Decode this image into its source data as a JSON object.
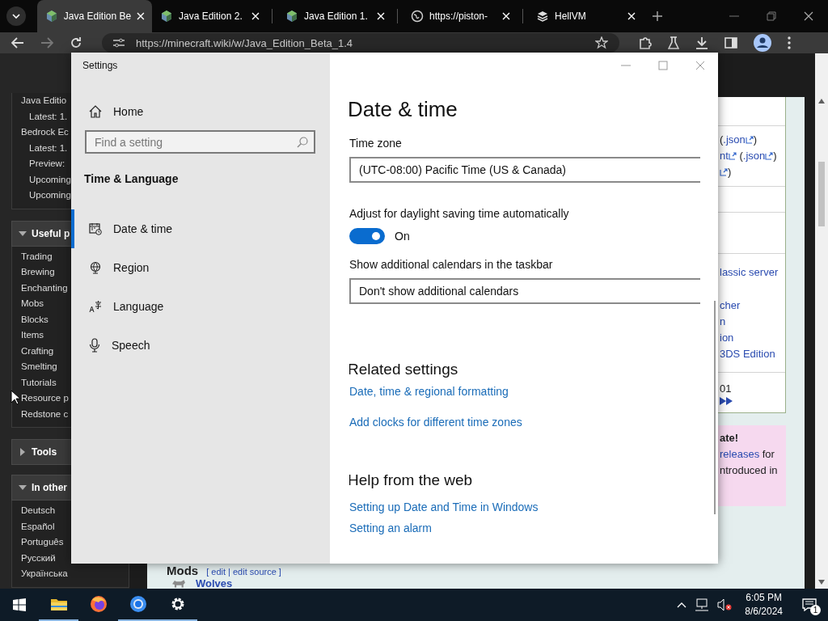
{
  "browser": {
    "tabs": [
      {
        "title": "Java Edition Be",
        "kind": "cube",
        "selected": true
      },
      {
        "title": "Java Edition 2.",
        "kind": "cube",
        "selected": false
      },
      {
        "title": "Java Edition 1.",
        "kind": "cube",
        "selected": false
      },
      {
        "title": "https://piston-",
        "kind": "globe",
        "selected": false
      },
      {
        "title": "HellVM",
        "kind": "vm",
        "selected": false
      }
    ],
    "address": "https://minecraft.wiki/w/Java_Edition_Beta_1.4"
  },
  "wiki": {
    "sidebar": [
      {
        "items": [
          {
            "label": "Java Editio",
            "children": [
              {
                "label": "Latest: 1."
              }
            ]
          },
          {
            "label": "Bedrock Ec",
            "children": [
              {
                "label": "Latest: 1."
              },
              {
                "label": "Preview: "
              },
              {
                "label": "Upcoming"
              },
              {
                "label": "Upcoming"
              }
            ]
          }
        ]
      },
      {
        "heading": "Useful p",
        "expanded": true,
        "items": [
          {
            "label": "Trading"
          },
          {
            "label": "Brewing"
          },
          {
            "label": "Enchanting"
          },
          {
            "label": "Mobs"
          },
          {
            "label": "Blocks"
          },
          {
            "label": "Items"
          },
          {
            "label": "Crafting"
          },
          {
            "label": "Smelting"
          },
          {
            "label": "Tutorials"
          },
          {
            "label": "Resource p"
          },
          {
            "label": "Redstone c"
          }
        ]
      },
      {
        "heading": "Tools",
        "expanded": false
      },
      {
        "heading": "In other",
        "expanded": true,
        "items": [
          {
            "label": "Deutsch"
          },
          {
            "label": "Español"
          },
          {
            "label": "Português"
          },
          {
            "label": "Русский"
          },
          {
            "label": "Українська"
          }
        ]
      }
    ],
    "infobox": [
      {
        "kind": "empty"
      },
      {
        "kind": "text",
        "lines": [
          [
            {
              "kind": "plain",
              "text": "("
            },
            {
              "kind": "link",
              "text": ".json"
            },
            {
              "kind": "ext"
            },
            {
              "kind": "plain",
              "text": ")"
            }
          ],
          [
            {
              "kind": "link",
              "text": "nt"
            },
            {
              "kind": "ext"
            },
            {
              "kind": "plain",
              "text": " ("
            },
            {
              "kind": "link",
              "text": ".json"
            },
            {
              "kind": "ext"
            },
            {
              "kind": "plain",
              "text": ")"
            }
          ],
          [
            {
              "kind": "ext"
            },
            {
              "kind": "plain",
              "text": ")"
            }
          ]
        ]
      },
      {
        "kind": "empty"
      },
      {
        "kind": "empty"
      },
      {
        "kind": "text",
        "lines": [
          [
            {
              "kind": "link",
              "text": "lassic server"
            }
          ],
          [
            {
              "kind": "link",
              "text": "cher",
              "spaced": true
            }
          ],
          [
            {
              "kind": "link",
              "text": "n"
            }
          ],
          [
            {
              "kind": "link",
              "text": "ion"
            }
          ],
          [
            {
              "kind": "link",
              "text": "3DS Edition"
            }
          ]
        ]
      },
      {
        "kind": "text",
        "lines": [
          [
            {
              "kind": "plain",
              "text": "01"
            }
          ],
          [
            {
              "kind": "arrows"
            }
          ]
        ]
      }
    ],
    "notice": [
      [
        {
          "kind": "bold",
          "text": "ate!"
        }
      ],
      [
        {
          "kind": "link",
          "text": "releases"
        },
        {
          "kind": "plain",
          "text": " for"
        }
      ],
      [
        {
          "kind": "plain",
          "text": "ntroduced in"
        }
      ]
    ],
    "section": {
      "heading": "Mods",
      "edit": "[ edit | edit source ]"
    },
    "entry": "Wolves"
  },
  "settings": {
    "title": "Settings",
    "home": "Home",
    "search_placeholder": "Find a setting",
    "section": "Time & Language",
    "nav": [
      {
        "label": "Date & time",
        "kind": "calendar",
        "selected": true
      },
      {
        "label": "Region",
        "kind": "globe",
        "selected": false
      },
      {
        "label": "Language",
        "kind": "language",
        "selected": false
      },
      {
        "label": "Speech",
        "kind": "mic",
        "selected": false
      }
    ],
    "page_title": "Date & time",
    "time_zone": {
      "label": "Time zone",
      "value": "(UTC-08:00) Pacific Time (US & Canada)"
    },
    "dst": {
      "label": "Adjust for daylight saving time automatically",
      "on": true,
      "state_text": "On"
    },
    "calendars": {
      "label": "Show additional calendars in the taskbar",
      "value": "Don't show additional calendars"
    },
    "related": {
      "heading": "Related settings",
      "links": [
        "Date, time & regional formatting",
        "Add clocks for different time zones"
      ]
    },
    "help": {
      "heading": "Help from the web",
      "links": [
        "Setting up Date and Time in Windows",
        "Setting an alarm"
      ]
    }
  },
  "taskbar": {
    "apps": [
      {
        "kind": "explorer",
        "running": true
      },
      {
        "kind": "firefox",
        "running": false
      },
      {
        "kind": "chrome",
        "running": true
      },
      {
        "kind": "settings",
        "running": true
      }
    ],
    "time": "6:05 PM",
    "date": "8/6/2024",
    "notifications": "1"
  }
}
